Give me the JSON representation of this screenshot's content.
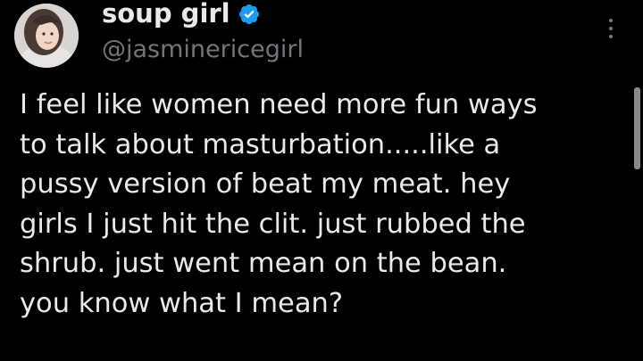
{
  "tweet": {
    "display_name": "soup girl",
    "handle": "@jasminericegirl",
    "verified_icon": "verified-badge-icon",
    "more_icon": "more-options-icon",
    "text_lines": [
      "I feel like women need more fun ways",
      "to talk about masturbation.....like a",
      "pussy version of beat my meat. hey",
      "girls I just hit the clit. just rubbed the",
      "shrub. just went mean on the bean.",
      "you know what I mean?"
    ]
  },
  "colors": {
    "background": "#000000",
    "primary_text": "#e7e9ea",
    "secondary_text": "#71767b",
    "verified_blue": "#1d9bf0"
  }
}
